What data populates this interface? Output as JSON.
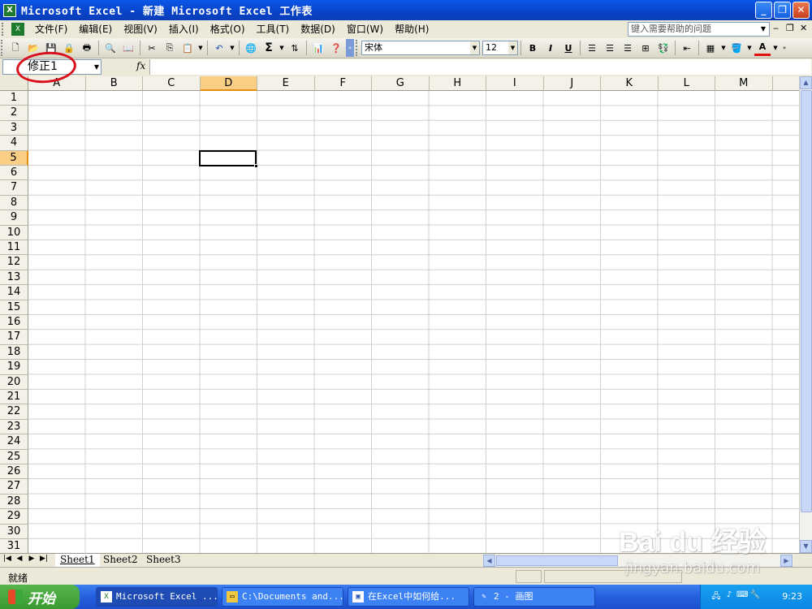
{
  "window": {
    "title": "Microsoft Excel - 新建 Microsoft Excel 工作表",
    "icon": "excel-icon",
    "min_label": "_",
    "restore_label": "❐",
    "close_label": "✕"
  },
  "menu": {
    "items": [
      "文件(F)",
      "编辑(E)",
      "视图(V)",
      "插入(I)",
      "格式(O)",
      "工具(T)",
      "数据(D)",
      "窗口(W)",
      "帮助(H)"
    ],
    "help_placeholder": "键入需要帮助的问题"
  },
  "toolbar": {
    "font_name": "宋体",
    "font_size": "12",
    "bold": "B",
    "italic": "I",
    "underline": "U",
    "sum": "Σ"
  },
  "formula_bar": {
    "name_box": "修正1",
    "fx": "fx",
    "formula": ""
  },
  "grid": {
    "columns": [
      "A",
      "B",
      "C",
      "D",
      "E",
      "F",
      "G",
      "H",
      "I",
      "J",
      "K",
      "L",
      "M"
    ],
    "rows": [
      "1",
      "2",
      "3",
      "4",
      "5",
      "6",
      "7",
      "8",
      "9",
      "10",
      "11",
      "12",
      "13",
      "14",
      "15",
      "16",
      "17",
      "18",
      "19",
      "20",
      "21",
      "22",
      "23",
      "24",
      "25",
      "26",
      "27",
      "28",
      "29",
      "30",
      "31"
    ],
    "active_cell": "D5",
    "selected_column": "D",
    "selected_row": "5"
  },
  "sheets": {
    "tabs": [
      "Sheet1",
      "Sheet2",
      "Sheet3"
    ],
    "active": "Sheet1"
  },
  "status": {
    "text": "就绪"
  },
  "watermark": {
    "logo": "Bai du 经验",
    "url": "jingyan.baidu.com"
  },
  "taskbar": {
    "start": "开始",
    "tasks": [
      "Microsoft Excel ...",
      "C:\\Documents and...",
      "在Excel中如何给...",
      "2 - 画图"
    ],
    "clock": "9:23"
  },
  "colors": {
    "title_bar": "#0842c8",
    "active_header": "#f9cf86",
    "circle": "#d8101c",
    "taskbar": "#245ede"
  }
}
